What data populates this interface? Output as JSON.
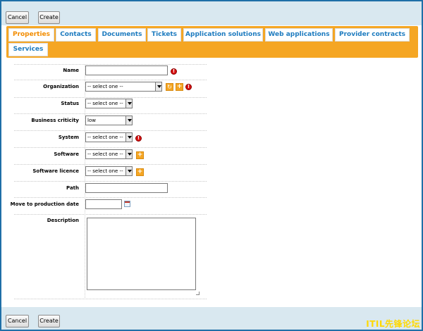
{
  "toolbar": {
    "cancel_label": "Cancel",
    "create_label": "Create"
  },
  "tabs": [
    {
      "label": "Properties",
      "active": true
    },
    {
      "label": "Contacts"
    },
    {
      "label": "Documents"
    },
    {
      "label": "Tickets"
    },
    {
      "label": "Application solutions"
    },
    {
      "label": "Web applications"
    },
    {
      "label": "Provider contracts"
    },
    {
      "label": "Services"
    }
  ],
  "form": {
    "name": {
      "label": "Name",
      "value": ""
    },
    "organization": {
      "label": "Organization",
      "value": "-- select one --"
    },
    "status": {
      "label": "Status",
      "value": "-- select one --"
    },
    "business_criticity": {
      "label": "Business criticity",
      "value": "low"
    },
    "system": {
      "label": "System",
      "value": "-- select one --"
    },
    "software": {
      "label": "Software",
      "value": "-- select one --"
    },
    "software_licence": {
      "label": "Software licence",
      "value": "-- select one --"
    },
    "path": {
      "label": "Path",
      "value": ""
    },
    "move_to_production_date": {
      "label": "Move to production date",
      "value": ""
    },
    "description": {
      "label": "Description",
      "value": ""
    }
  },
  "icons": {
    "required": "exclamation-icon",
    "add": "plus-icon",
    "refresh": "refresh-icon",
    "calendar": "calendar-icon"
  },
  "colors": {
    "accent": "#f5a623",
    "tab_text": "#1d7bbf",
    "tab_active_text": "#f28c00",
    "toolbar_bg": "#d9e8f0",
    "frame_border": "#1f6fa8",
    "required": "#d81010"
  },
  "watermark": "ITIL先锋论坛"
}
